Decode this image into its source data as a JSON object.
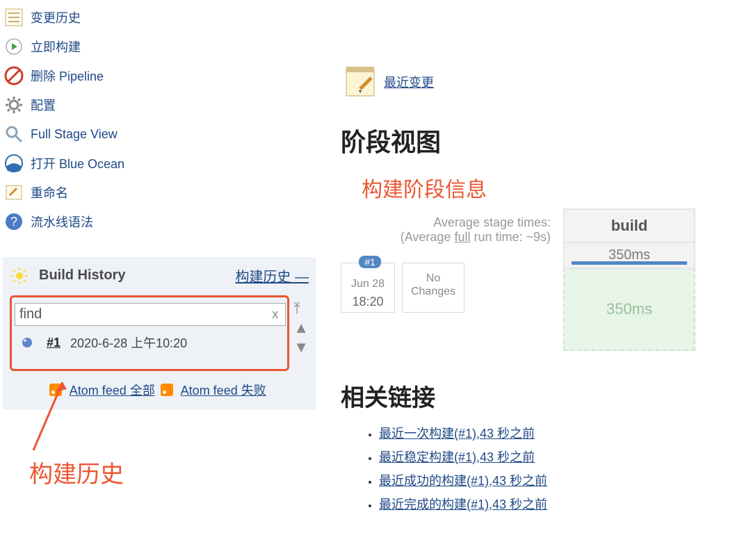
{
  "sidebar": {
    "items": [
      {
        "label": "变更历史",
        "icon": "history-icon"
      },
      {
        "label": "立即构建",
        "icon": "clock-play-icon"
      },
      {
        "label": "删除 Pipeline",
        "icon": "delete-icon"
      },
      {
        "label": "配置",
        "icon": "gear-icon"
      },
      {
        "label": "Full Stage View",
        "icon": "search-icon"
      },
      {
        "label": "打开 Blue Ocean",
        "icon": "blue-ocean-icon"
      },
      {
        "label": "重命名",
        "icon": "rename-icon"
      },
      {
        "label": "流水线语法",
        "icon": "help-icon"
      }
    ]
  },
  "build_history": {
    "title": "Build History",
    "trend_label": "构建历史",
    "trend_dash": "—",
    "find_value": "find",
    "clear_label": "x",
    "item_num": "#1",
    "item_date": "2020-6-28 上午10:20",
    "feed_all": "Atom feed 全部",
    "feed_fail": "Atom feed 失败"
  },
  "annotations": {
    "build_history": "构建历史",
    "stage_info": "构建阶段信息"
  },
  "recent_changes": {
    "label": "最近变更"
  },
  "stage": {
    "heading": "阶段视图",
    "avg_line1": "Average stage times:",
    "avg_line2_a": "(Average ",
    "avg_line2_b": "full",
    "avg_line2_c": " run time: ~9s)",
    "build_head": "build",
    "build_time": "350ms",
    "cell_time": "350ms",
    "card_badge": "#1",
    "card_date": "Jun 28",
    "card_time": "18:20",
    "no_changes_a": "No",
    "no_changes_b": "Changes"
  },
  "links": {
    "heading": "相关链接",
    "items": [
      "最近一次构建(#1),43 秒之前",
      "最近稳定构建(#1),43 秒之前",
      "最近成功的构建(#1),43 秒之前",
      "最近完成的构建(#1),43 秒之前"
    ]
  }
}
